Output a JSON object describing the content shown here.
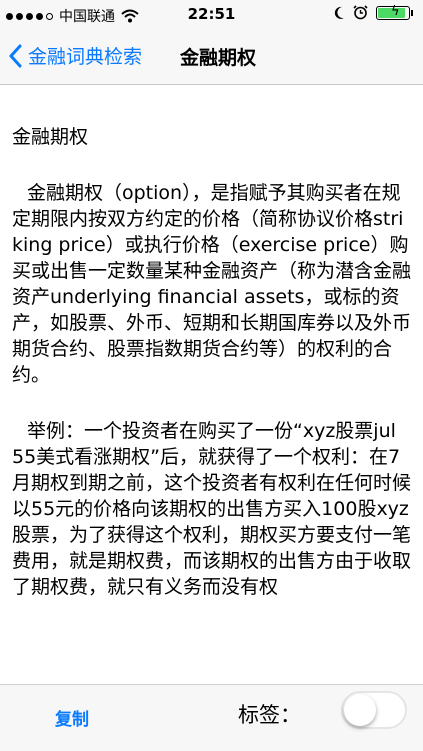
{
  "status_bar": {
    "carrier": "中国联通",
    "time": "22:51",
    "battery_percent": 100
  },
  "nav": {
    "back_label": "金融词典检索",
    "title": "金融期权"
  },
  "content": {
    "heading": "金融期权",
    "paragraph_1": "金融期权（option），是指赋予其购买者在规定期限内按双方约定的价格（简称协议价格striking price）或执行价格（exercise price）购买或出售一定数量某种金融资产（称为潜含金融资产underlying financial assets，或标的资产，如股票、外币、短期和长期国库券以及外币期货合约、股票指数期货合约等）的权利的合约。",
    "paragraph_2": "举例：一个投资者在购买了一份“xyz股票jul 55美式看涨期权”后，就获得了一个权利：在7月期权到期之前，这个投资者有权利在任何时候以55元的价格向该期权的出售方买入100股xyz股票，为了获得这个权利，期权买方要支付一笔费用，就是期权费，而该期权的出售方由于收取了期权费，就只有义务而没有权"
  },
  "toolbar": {
    "copy_label": "复制",
    "tag_label": "标签：",
    "tag_switch_on": false
  },
  "colors": {
    "accent": "#0a7aff",
    "battery": "#4cd964"
  }
}
